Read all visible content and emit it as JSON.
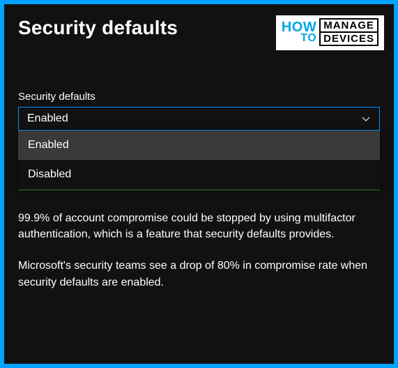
{
  "header": {
    "title": "Security defaults"
  },
  "logo": {
    "how": "HOW",
    "to": "TO",
    "manage": "MANAGE",
    "devices": "DEVICES"
  },
  "field": {
    "label": "Security defaults",
    "selected": "Enabled",
    "options": [
      {
        "label": "Enabled",
        "hover": true
      },
      {
        "label": "Disabled",
        "hover": false
      }
    ]
  },
  "description": {
    "p1": "99.9% of account compromise could be stopped by using multifactor authentication, which is a feature that security defaults provides.",
    "p2": "Microsoft's security teams see a drop of 80% in compromise rate when security defaults are enabled."
  }
}
